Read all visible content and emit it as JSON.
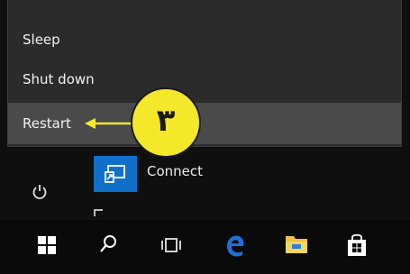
{
  "power_menu": {
    "items": [
      {
        "label": "Sleep"
      },
      {
        "label": "Shut down"
      },
      {
        "label": "Restart",
        "highlighted": true
      }
    ]
  },
  "start_menu": {
    "connect_tile": {
      "label": "Connect",
      "icon": "connect-icon"
    },
    "power_icon": "power-icon"
  },
  "taskbar": {
    "icons": [
      "windows-start-icon",
      "search-icon",
      "task-view-icon",
      "edge-icon",
      "file-explorer-icon",
      "store-icon"
    ]
  },
  "annotation": {
    "step_number": "٣",
    "color": "#f5e72a"
  },
  "colors": {
    "menu_bg": "#2b2b2b",
    "highlight_bg": "#4a4a4a",
    "tile_blue": "#1070c9",
    "edge_blue": "#1e6fd9",
    "explorer_yellow": "#f2c23a"
  }
}
